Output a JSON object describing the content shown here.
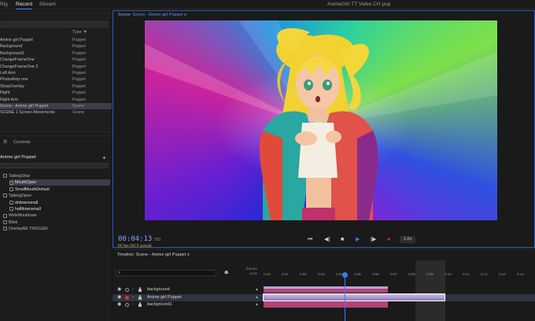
{
  "topbar": {
    "tabs": [
      {
        "label": "Rig",
        "active": false
      },
      {
        "label": "Record",
        "active": true
      },
      {
        "label": "Stream",
        "active": false
      }
    ],
    "app_title": "AnimeGirl TT Video CH pup"
  },
  "project": {
    "type_header": "Type",
    "items": [
      {
        "name": "Anime girl Puppet",
        "type": "Puppet"
      },
      {
        "name": "Background",
        "type": "Puppet"
      },
      {
        "name": "Background1",
        "type": "Puppet"
      },
      {
        "name": "ChangeFrameOne",
        "type": "Puppet"
      },
      {
        "name": "ChangeFrameOne 2",
        "type": "Puppet"
      },
      {
        "name": "Left Arm",
        "type": "Puppet"
      },
      {
        "name": "Photoshop one",
        "type": "Puppet"
      },
      {
        "name": "ShopOverlay",
        "type": "Puppet"
      },
      {
        "name": "Right",
        "type": "Puppet"
      },
      {
        "name": "Right Arm",
        "type": "Puppet"
      },
      {
        "name": "Scene - Anime girl Puppet",
        "type": "Scene",
        "selected": true
      },
      {
        "name": "SCENE 1 Screen Movements",
        "type": "Scene"
      }
    ]
  },
  "controls": {
    "tab_label": "Controls",
    "puppet_title": "Anime girl Puppet",
    "plus_label": "+",
    "items": [
      {
        "label": "TalkingShut",
        "indent": 0,
        "bold": false,
        "selected": false
      },
      {
        "label": "MouthOpen",
        "indent": 1,
        "bold": true,
        "selected": true
      },
      {
        "label": "SmallMouthDefault",
        "indent": 1,
        "bold": true,
        "selected": false
      },
      {
        "label": "TalkingOpen",
        "indent": 0,
        "bold": false,
        "selected": false
      },
      {
        "label": "drdownsmall",
        "indent": 1,
        "bold": true,
        "selected": false
      },
      {
        "label": "halfdownsmall",
        "indent": 1,
        "bold": true,
        "selected": false
      },
      {
        "label": "WideMouthsaw",
        "indent": 0,
        "bold": false,
        "selected": false
      },
      {
        "label": "Blink",
        "indent": 0,
        "bold": false,
        "selected": false
      },
      {
        "label": "OverlayBE TRIGGER",
        "indent": 0,
        "bold": false,
        "selected": false
      }
    ]
  },
  "scene": {
    "title_prefix": "Scene: ",
    "title_name": "Scene - Anime girl Puppet",
    "timecode": "00:04:13",
    "frame_count": "253",
    "fps_text": "60 fps (60.5 actual)",
    "speed": "1.0x"
  },
  "timeline": {
    "title": "Timeline: Scene - Anime girl Puppet",
    "frames_label": "frames",
    "mm_label": "m:ss",
    "ticks": [
      "0:00",
      "0:01",
      "0:02",
      "0:03",
      "0:04",
      "0:05",
      "0:06",
      "0:07",
      "0:08",
      "0:09",
      "0:10",
      "0:11",
      "0:12",
      "0:13",
      "0:14",
      "0:15"
    ],
    "tracks": [
      {
        "name": "background",
        "record": false,
        "selected": false
      },
      {
        "name": "Anime girl Puppet",
        "record": true,
        "selected": true
      },
      {
        "name": "background1",
        "record": false,
        "selected": false
      }
    ]
  },
  "colors": {
    "accent": "#3a7bff",
    "record": "#e03030",
    "track_pink": "#b2447a",
    "track_lavender": "#b7a0d8"
  }
}
